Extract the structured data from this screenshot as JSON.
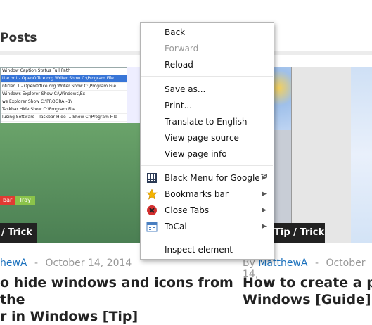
{
  "page": {
    "section_title": "Posts"
  },
  "left_post": {
    "thumb_window": {
      "rows": [
        "Window Caption  Status  Full Path",
        "ttle.odt - OpenOffice.org Writer  Show  C:\\Program File",
        "ntitled 1 - OpenOffice.org Writer  Show  C:\\Program File",
        "Windows Explorer  Show  C:\\Windows\\Ex",
        "ws Explorer  Show  C:\\PROGRA~1\\",
        "Taskbar Hide  Show  C:\\Program File",
        "lusing Software - Taskbar Hide ...  Show  C:\\Program File"
      ]
    },
    "tray_labels": {
      "left": "bar",
      "right": "Tray"
    },
    "tag": "/ Trick",
    "meta_author": "hewA",
    "meta_sep": "-",
    "meta_date": "October 14, 2014",
    "title_line1": "o hide windows and icons from the",
    "title_line2": "r in Windows [Tip]"
  },
  "right_post": {
    "tag": "Tip / Trick",
    "meta_by": "By",
    "meta_author": "MatthewA",
    "meta_sep": "-",
    "meta_date": "October 14,",
    "title_line1": "How to create a pho",
    "title_line2": "Windows [Guide]"
  },
  "context_menu": {
    "items": [
      {
        "label": "Back",
        "enabled": true
      },
      {
        "label": "Forward",
        "enabled": false
      },
      {
        "label": "Reload",
        "enabled": true
      },
      {
        "label": "Save as...",
        "enabled": true
      },
      {
        "label": "Print...",
        "enabled": true
      },
      {
        "label": "Translate to English",
        "enabled": true
      },
      {
        "label": "View page source",
        "enabled": true
      },
      {
        "label": "View page info",
        "enabled": true
      },
      {
        "label": "Black Menu for Google™",
        "enabled": true,
        "submenu": true,
        "icon": "black-menu-icon"
      },
      {
        "label": "Bookmarks bar",
        "enabled": true,
        "submenu": true,
        "icon": "star-icon"
      },
      {
        "label": "Close Tabs",
        "enabled": true,
        "submenu": true,
        "icon": "close-tabs-icon"
      },
      {
        "label": "ToCal",
        "enabled": true,
        "submenu": true,
        "icon": "calendar-icon"
      },
      {
        "label": "Inspect element",
        "enabled": true
      }
    ],
    "submenu_arrow": "▶"
  },
  "colors": {
    "link": "#1e73be",
    "tag_bg": "#222222",
    "menu_border": "#b5b5b5",
    "disabled_text": "#9a9a9a"
  }
}
